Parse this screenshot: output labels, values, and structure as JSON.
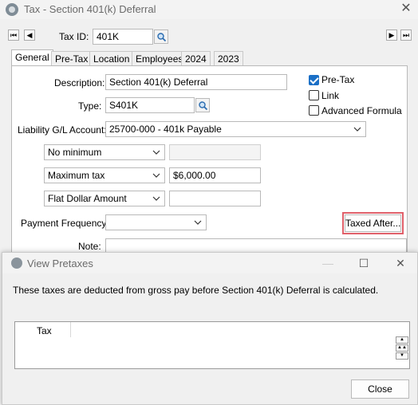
{
  "window": {
    "title": "Tax - Section 401(k) Deferral"
  },
  "record_nav": {
    "first": "⏮",
    "prev": "◀",
    "next": "▶",
    "last": "⏭"
  },
  "header": {
    "tax_id_label": "Tax ID:",
    "tax_id_value": "401K"
  },
  "tabs": [
    {
      "label": "General",
      "active": true
    },
    {
      "label": "Pre-Tax"
    },
    {
      "label": "Location"
    },
    {
      "label": "Employees"
    },
    {
      "label": "2024"
    },
    {
      "label": "2023"
    }
  ],
  "general": {
    "description_label": "Description:",
    "description_value": "Section 401(k) Deferral",
    "type_label": "Type:",
    "type_value": "S401K",
    "liability_label": "Liability G/L Account:",
    "liability_value": "25700-000 - 401k Payable",
    "minimum_select": "No minimum",
    "minimum_amount": "",
    "maximum_select": "Maximum tax",
    "maximum_amount": "$6,000.00",
    "calc_select": "Flat Dollar Amount",
    "calc_amount": "",
    "payment_freq_label": "Payment Frequency:",
    "payment_freq_value": "",
    "note_label": "Note:",
    "taxed_after_label": "Taxed After...",
    "checkboxes": [
      {
        "label": "Pre-Tax",
        "checked": true
      },
      {
        "label": "Link",
        "checked": false
      },
      {
        "label": "Advanced Formula",
        "checked": false
      }
    ]
  },
  "dialog": {
    "title": "View Pretaxes",
    "message": "These taxes are deducted from gross pay before Section 401(k) Deferral is calculated.",
    "grid_column": "Tax",
    "close_label": "Close",
    "minimize": "—",
    "maximize": "☐",
    "close_icon": "✕"
  },
  "colors": {
    "accent": "#1a6fc6",
    "highlight": "#e0606a"
  }
}
